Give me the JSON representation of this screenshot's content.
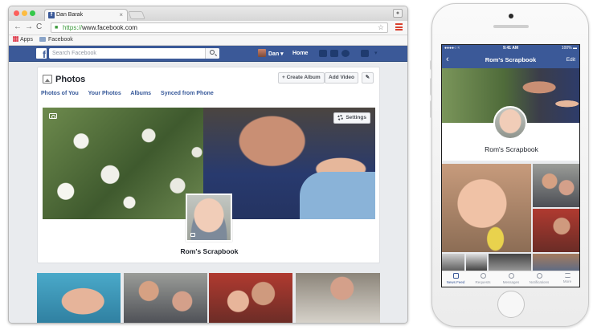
{
  "browser": {
    "tab_title": "Dan Barak",
    "url_scheme": "https://",
    "url_rest": "www.facebook.com",
    "bookmarks": [
      "Apps",
      "Facebook"
    ]
  },
  "facebook_bar": {
    "search_placeholder": "Search Facebook",
    "user_name": "Dan",
    "home_label": "Home"
  },
  "photos_card": {
    "title": "Photos",
    "create_album_label": "+ Create Album",
    "add_video_label": "Add Video",
    "subnav": [
      "Photos of You",
      "Your Photos",
      "Albums",
      "Synced from Phone"
    ],
    "settings_label": "Settings",
    "album_name": "Rom's Scrapbook"
  },
  "phone": {
    "status_left": "●●●●○ ≈",
    "status_time": "9:41 AM",
    "status_battery": "100% ▬",
    "nav_title": "Rom's Scrapbook",
    "nav_edit": "Edit",
    "album_name": "Rom's Scrapbook",
    "tabs": [
      "News Feed",
      "Requests",
      "Messages",
      "Notifications",
      "More"
    ]
  },
  "colors": {
    "facebook_blue": "#3b5998",
    "page_bg": "#e9ebee",
    "link_blue": "#365899"
  }
}
